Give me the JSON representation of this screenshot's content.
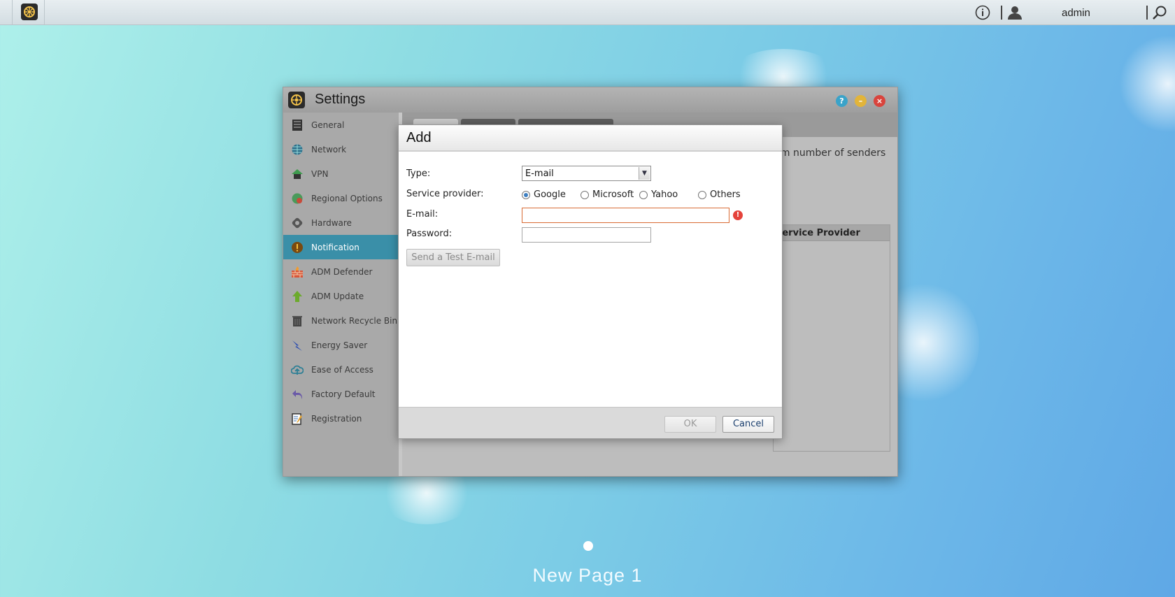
{
  "taskbar": {
    "user_name": "admin",
    "icons": [
      "adm-logo-icon",
      "info-icon",
      "user-icon",
      "search-icon"
    ]
  },
  "window": {
    "title": "Settings",
    "controls": [
      "help-icon",
      "minimize-icon",
      "close-icon"
    ]
  },
  "sidebar": {
    "items": [
      {
        "label": "General",
        "icon": "general-icon",
        "active": false
      },
      {
        "label": "Network",
        "icon": "network-globe-icon",
        "active": false
      },
      {
        "label": "VPN",
        "icon": "vpn-icon",
        "active": false
      },
      {
        "label": "Regional Options",
        "icon": "regional-globe-icon",
        "active": false
      },
      {
        "label": "Hardware",
        "icon": "hardware-icon",
        "active": false
      },
      {
        "label": "Notification",
        "icon": "notification-icon",
        "active": true
      },
      {
        "label": "ADM Defender",
        "icon": "firewall-icon",
        "active": false
      },
      {
        "label": "ADM Update",
        "icon": "update-arrow-icon",
        "active": false
      },
      {
        "label": "Network Recycle Bin",
        "icon": "recycle-bin-icon",
        "active": false
      },
      {
        "label": "Energy Saver",
        "icon": "energy-icon",
        "active": false
      },
      {
        "label": "Ease of Access",
        "icon": "cloud-access-icon",
        "active": false
      },
      {
        "label": "Factory Default",
        "icon": "reset-arrow-icon",
        "active": false
      },
      {
        "label": "Registration",
        "icon": "registration-icon",
        "active": false
      }
    ]
  },
  "background_content": {
    "text": "um number of senders",
    "grid_header": "Service Provider"
  },
  "dialog": {
    "title": "Add",
    "type_label": "Type:",
    "type_value": "E-mail",
    "provider_label": "Service provider:",
    "providers": [
      {
        "label": "Google",
        "checked": true
      },
      {
        "label": "Microsoft",
        "checked": false
      },
      {
        "label": "Yahoo",
        "checked": false
      },
      {
        "label": "Others",
        "checked": false
      }
    ],
    "email_label": "E-mail:",
    "email_value": "",
    "password_label": "Password:",
    "password_value": "",
    "test_button": "Send a Test E-mail",
    "ok_button": "OK",
    "cancel_button": "Cancel"
  },
  "desktop": {
    "page_label": "New Page 1"
  },
  "colors": {
    "active_sidebar": "#3a8fa8",
    "error_border": "#d96b33",
    "error_icon": "#e5433b"
  }
}
